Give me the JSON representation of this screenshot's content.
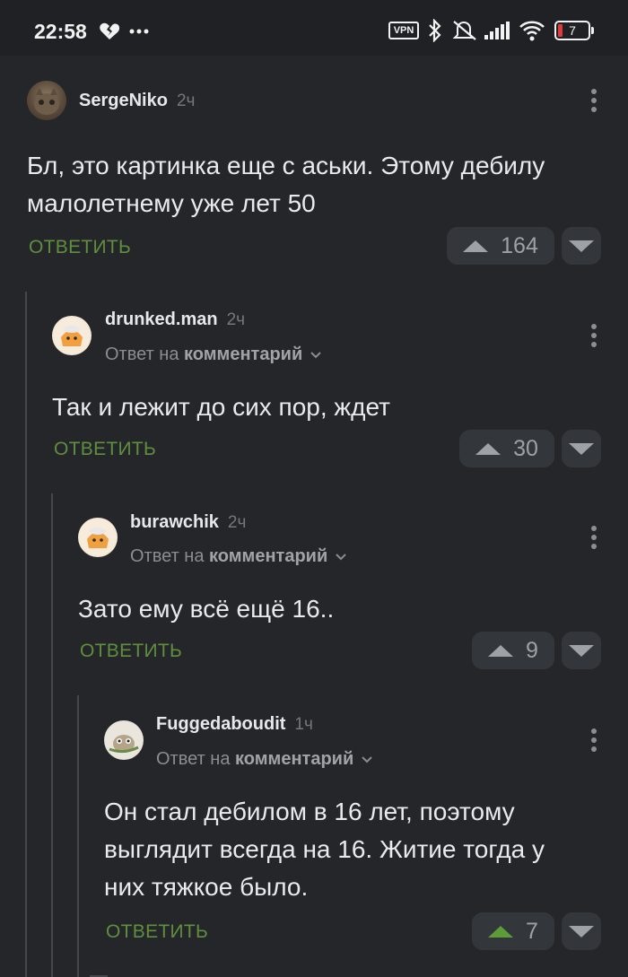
{
  "status_bar": {
    "time": "22:58",
    "left_icons": [
      "heart-broken-icon",
      "more-icon"
    ],
    "right_icons": [
      "vpn-icon",
      "bluetooth-icon",
      "mute-icon",
      "signal-icon",
      "wifi-icon",
      "battery-icon"
    ],
    "vpn_label": "VPN",
    "battery_level": "7"
  },
  "comments": [
    {
      "author": "SergeNiko",
      "time": "2ч",
      "reply_prefix": "",
      "reply_link": "",
      "text_lines": [
        "Бл, это картинка еще с аськи. Этому дебилу",
        "малолетнему уже лет 50"
      ],
      "reply_label": "ОТВЕТИТЬ",
      "rating": "164",
      "voted_up": false
    },
    {
      "author": "drunked.man",
      "time": "2ч",
      "reply_prefix": "Ответ на",
      "reply_link": "комментарий",
      "text_lines": [
        "Так и лежит до сих пор, ждет"
      ],
      "reply_label": "ОТВЕТИТЬ",
      "rating": "30",
      "voted_up": false
    },
    {
      "author": "burawchik",
      "time": "2ч",
      "reply_prefix": "Ответ на",
      "reply_link": "комментарий",
      "text_lines": [
        "Зато ему всё ещё 16.."
      ],
      "reply_label": "ОТВЕТИТЬ",
      "rating": "9",
      "voted_up": false
    },
    {
      "author": "Fuggedaboudit",
      "time": "1ч",
      "reply_prefix": "Ответ на",
      "reply_link": "комментарий",
      "text_lines": [
        "Он стал дебилом в 16 лет, поэтому",
        "выглядит всегда на 16. Житие тогда у",
        "них тяжкое было."
      ],
      "reply_label": "ОТВЕТИТЬ",
      "rating": "7",
      "voted_up": true
    }
  ],
  "colors": {
    "background": "#24262a",
    "accent_green": "#5f8f3e",
    "vote_bg": "#33363b"
  }
}
